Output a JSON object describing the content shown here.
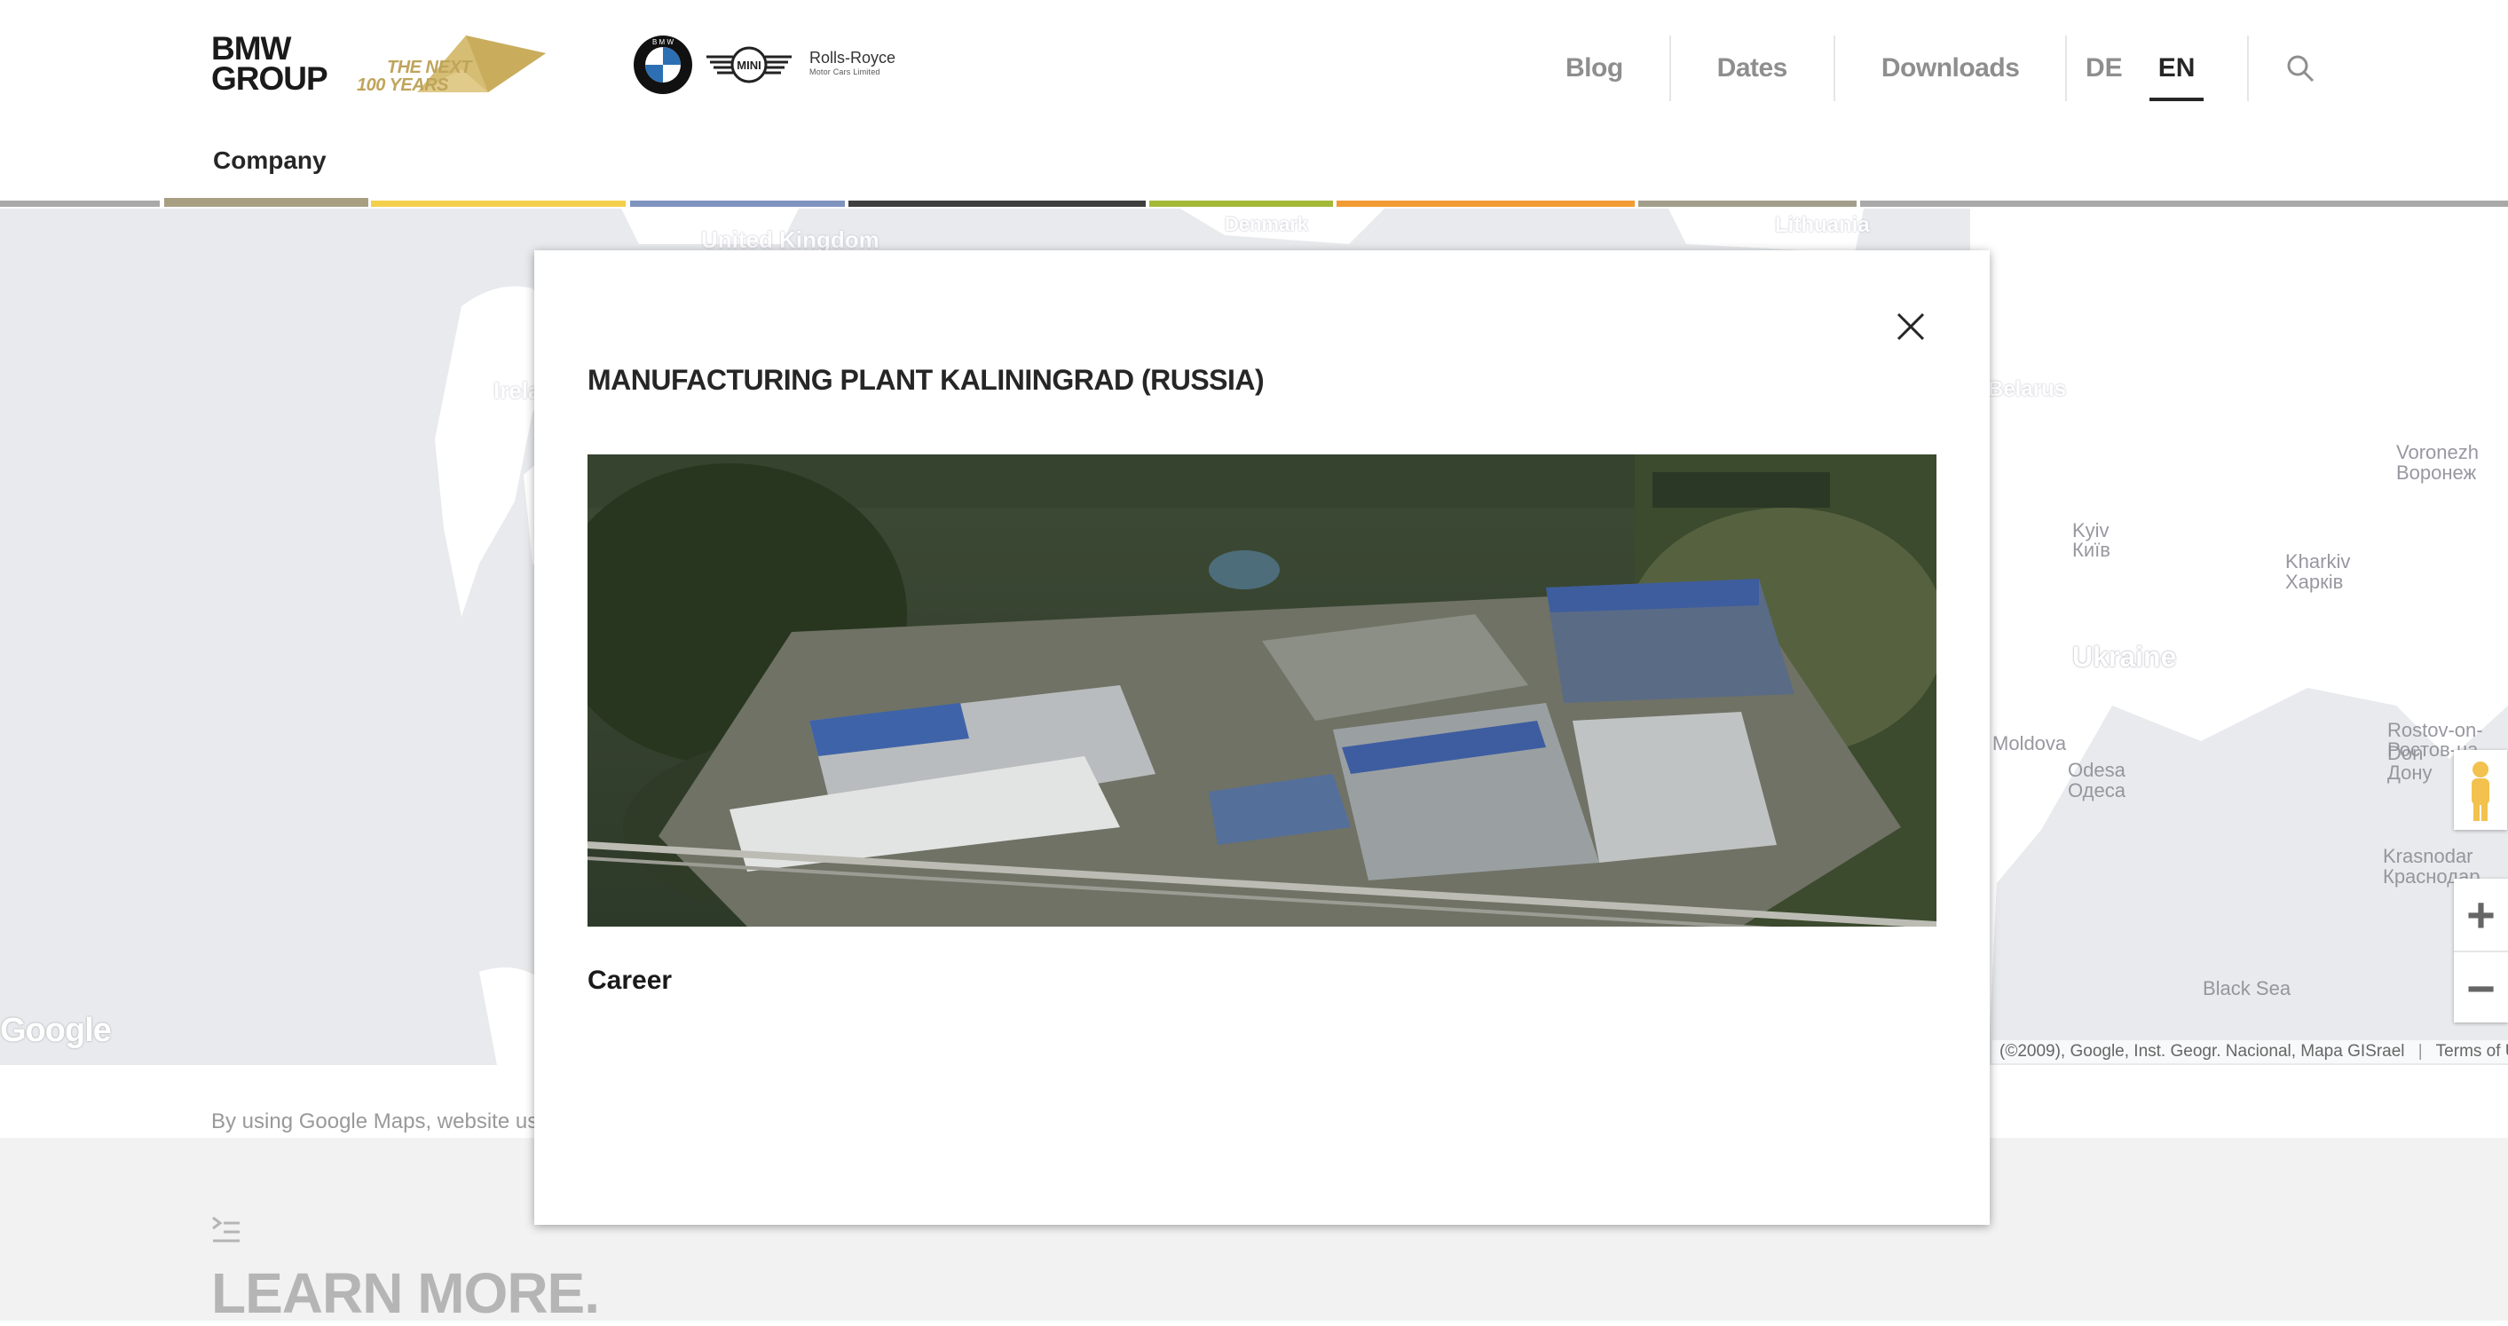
{
  "header": {
    "logo_line1": "BMW",
    "logo_line2": "GROUP",
    "tagline_line1": "THE NEXT",
    "tagline_line2": "100 YEARS",
    "brand_rolls_royce": "Rolls-Royce",
    "brand_rolls_royce_sub": "Motor Cars Limited",
    "brand_mini": "MINI",
    "brand_bmw": "B M W",
    "nav": [
      {
        "label": "Blog"
      },
      {
        "label": "Dates"
      },
      {
        "label": "Downloads"
      }
    ],
    "languages": [
      {
        "label": "DE",
        "active": false
      },
      {
        "label": "EN",
        "active": true
      }
    ],
    "section": "Company"
  },
  "color_bar": {
    "segments": [
      "#a9a9a9",
      "#a89f83",
      "#f4cf4c",
      "#7f93bf",
      "#3f3f3f",
      "#a4b935",
      "#f29b34",
      "#a39e8b",
      "#a9a9a9"
    ]
  },
  "map": {
    "labels": [
      "Denmark",
      "Lithuania",
      "Ireland",
      "Belarus",
      "Voronezh",
      "Воронеж",
      "Kyiv",
      "Київ",
      "Kharkiv",
      "Харків",
      "Ukraine",
      "Moldova",
      "Odesa",
      "Одеса",
      "Rostov-on-Don",
      "Ростов-на-Дону",
      "Krasnodar",
      "Краснодар",
      "Black Sea",
      "United Kingdom"
    ],
    "google_mark": "Google",
    "attribution": "(©2009), Google, Inst. Geogr. Nacional, Mapa GISrael",
    "terms": "Terms of U",
    "zoom_in": "+",
    "zoom_out": "−"
  },
  "disclaimer": "By using Google Maps, website us",
  "learn_more": {
    "title": "LEARN MORE."
  },
  "modal": {
    "title": "MANUFACTURING PLANT KALININGRAD (RUSSIA)",
    "link": "Career"
  }
}
